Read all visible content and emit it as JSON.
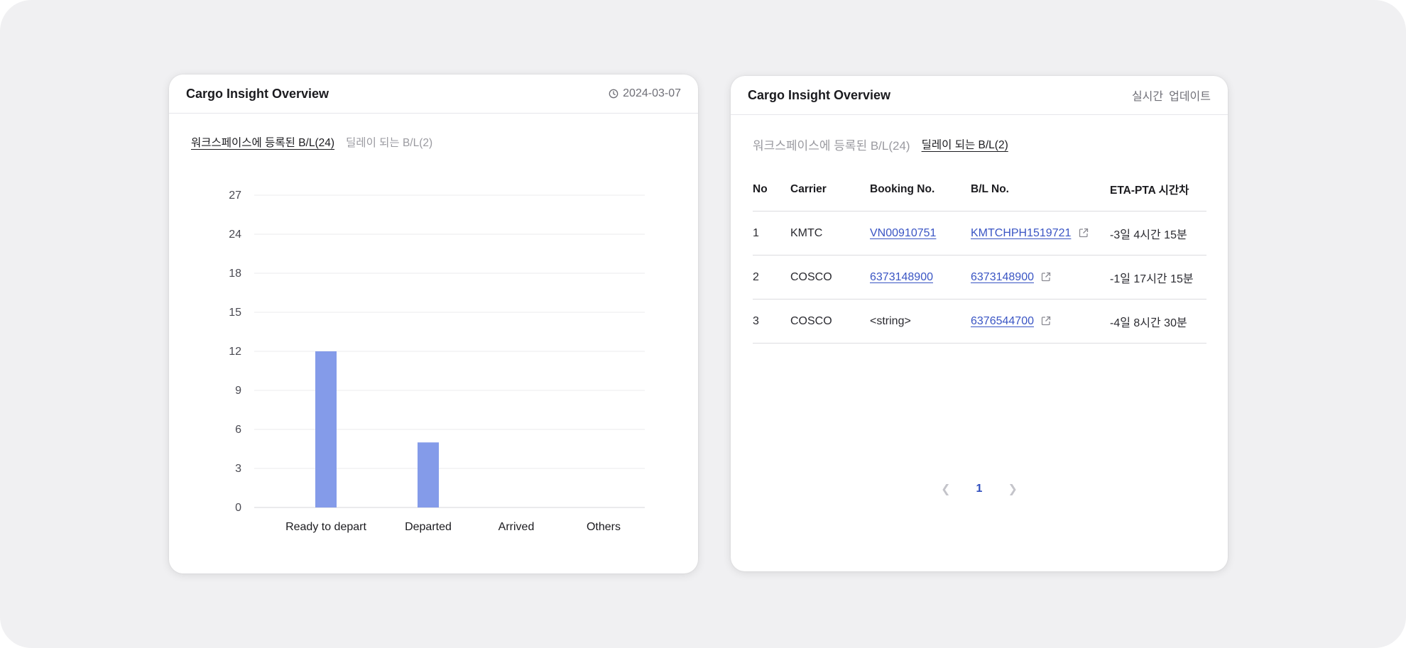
{
  "left_card": {
    "title": "Cargo Insight Overview",
    "date": "2024-03-07",
    "tabs": [
      {
        "label": "워크스페이스에 등록된 B/L(24)",
        "active": true
      },
      {
        "label": "딜레이 되는 B/L(2)",
        "active": false
      }
    ]
  },
  "right_card": {
    "title": "Cargo Insight Overview",
    "realtime_label": "실시간",
    "update_label": "업데이트",
    "tabs": [
      {
        "label": "워크스페이스에 등록된 B/L(24)",
        "active": false
      },
      {
        "label": "딜레이 되는 B/L(2)",
        "active": true
      }
    ],
    "table": {
      "headers": [
        "No",
        "Carrier",
        "Booking No.",
        "B/L No.",
        "ETA-PTA 시간차"
      ],
      "rows": [
        {
          "no": "1",
          "carrier": "KMTC",
          "booking": "VN00910751",
          "bl": "KMTCHPH1519721",
          "eta": "-3일 4시간 15분"
        },
        {
          "no": "2",
          "carrier": "COSCO",
          "booking": "6373148900",
          "bl": "6373148900",
          "eta": "-1일 17시간 15분"
        },
        {
          "no": "3",
          "carrier": "COSCO",
          "booking": "<string>",
          "bl": "6376544700",
          "eta": "-4일 8시간 30분"
        }
      ]
    },
    "pagination": {
      "current": "1",
      "prev_icon": "chevron-left-icon",
      "next_icon": "chevron-right-icon"
    }
  },
  "colors": {
    "bar": "#849be9",
    "link": "#3a55c4",
    "eta_negative": "#c8283c",
    "page_active": "#2f4dbd"
  },
  "icons": {
    "date": "clock-icon",
    "external": "external-link-icon"
  },
  "chart_data": {
    "type": "bar",
    "categories": [
      "Ready to depart",
      "Departed",
      "Arrived",
      "Others"
    ],
    "values": [
      12,
      5,
      0,
      0
    ],
    "y_ticks": [
      "0",
      "3",
      "6",
      "9",
      "12",
      "15",
      "18",
      "24",
      "27"
    ],
    "xlabel": "",
    "ylabel": "",
    "grid": true
  }
}
